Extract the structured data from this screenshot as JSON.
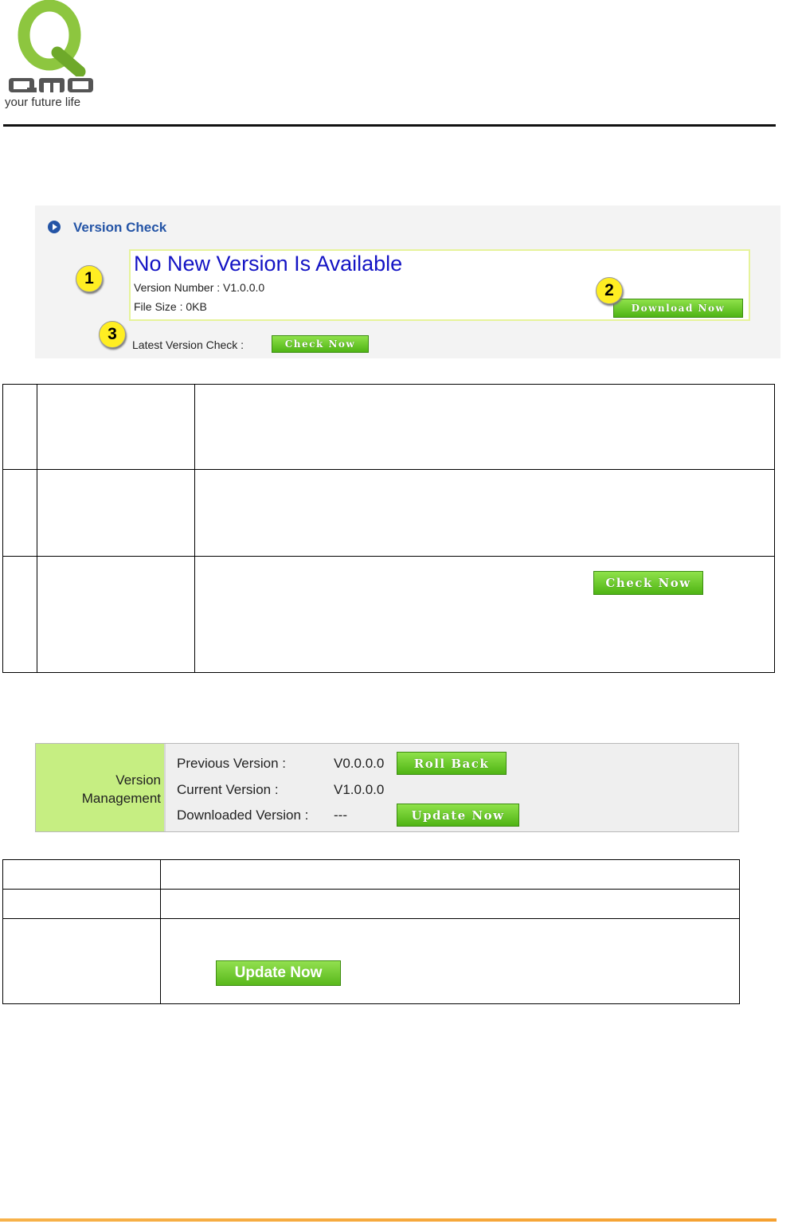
{
  "logo": {
    "brand": "QNO",
    "tagline": "your future life"
  },
  "version_check": {
    "title": "Version Check",
    "status": "No New Version Is Available",
    "version_number": "Version Number : V1.0.0.0",
    "file_size": "File Size : 0KB",
    "download_button": "Download Now",
    "latest_check_label": "Latest Version Check :",
    "check_button": "Check Now",
    "badges": [
      "1",
      "2",
      "3"
    ]
  },
  "table1": {
    "check_now_button": "Check Now"
  },
  "version_management": {
    "label_line1": "Version",
    "label_line2": "Management",
    "rows": [
      {
        "label": "Previous Version :",
        "value": "V0.0.0.0",
        "button": "Roll Back"
      },
      {
        "label": "Current Version :",
        "value": "V1.0.0.0",
        "button": ""
      },
      {
        "label": "Downloaded Version :",
        "value": "---",
        "button": "Update Now"
      }
    ]
  },
  "table2": {
    "update_now_button": "Update Now"
  },
  "colors": {
    "brand_green": "#7bbf2a",
    "title_blue": "#2454a6",
    "headline_blue": "#1313c4",
    "accent_orange": "#f5a030"
  }
}
